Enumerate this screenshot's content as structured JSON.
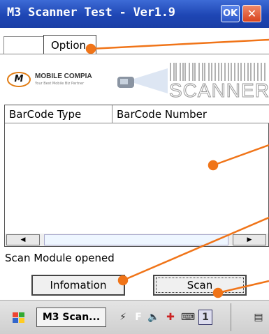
{
  "window": {
    "title": "M3 Scanner Test - Ver1.9",
    "ok_label": "OK",
    "close_label": "✕"
  },
  "tabs": [
    {
      "label": ""
    },
    {
      "label": "Option"
    }
  ],
  "banner": {
    "brand": "MOBILE COMPIA",
    "tagline": "Your Best Mobile Biz Partner",
    "product": "SCANNER"
  },
  "grid": {
    "columns": [
      "BarCode Type",
      "BarCode Number"
    ],
    "rows": []
  },
  "status": "Scan Module opened",
  "buttons": {
    "info": "Infomation",
    "scan": "Scan"
  },
  "taskbar": {
    "task_label": "M3 Scan...",
    "tray_input": "F",
    "tray_number": "1"
  },
  "colors": {
    "titlebar": "#1e46b4",
    "annotation": "#f07418"
  }
}
